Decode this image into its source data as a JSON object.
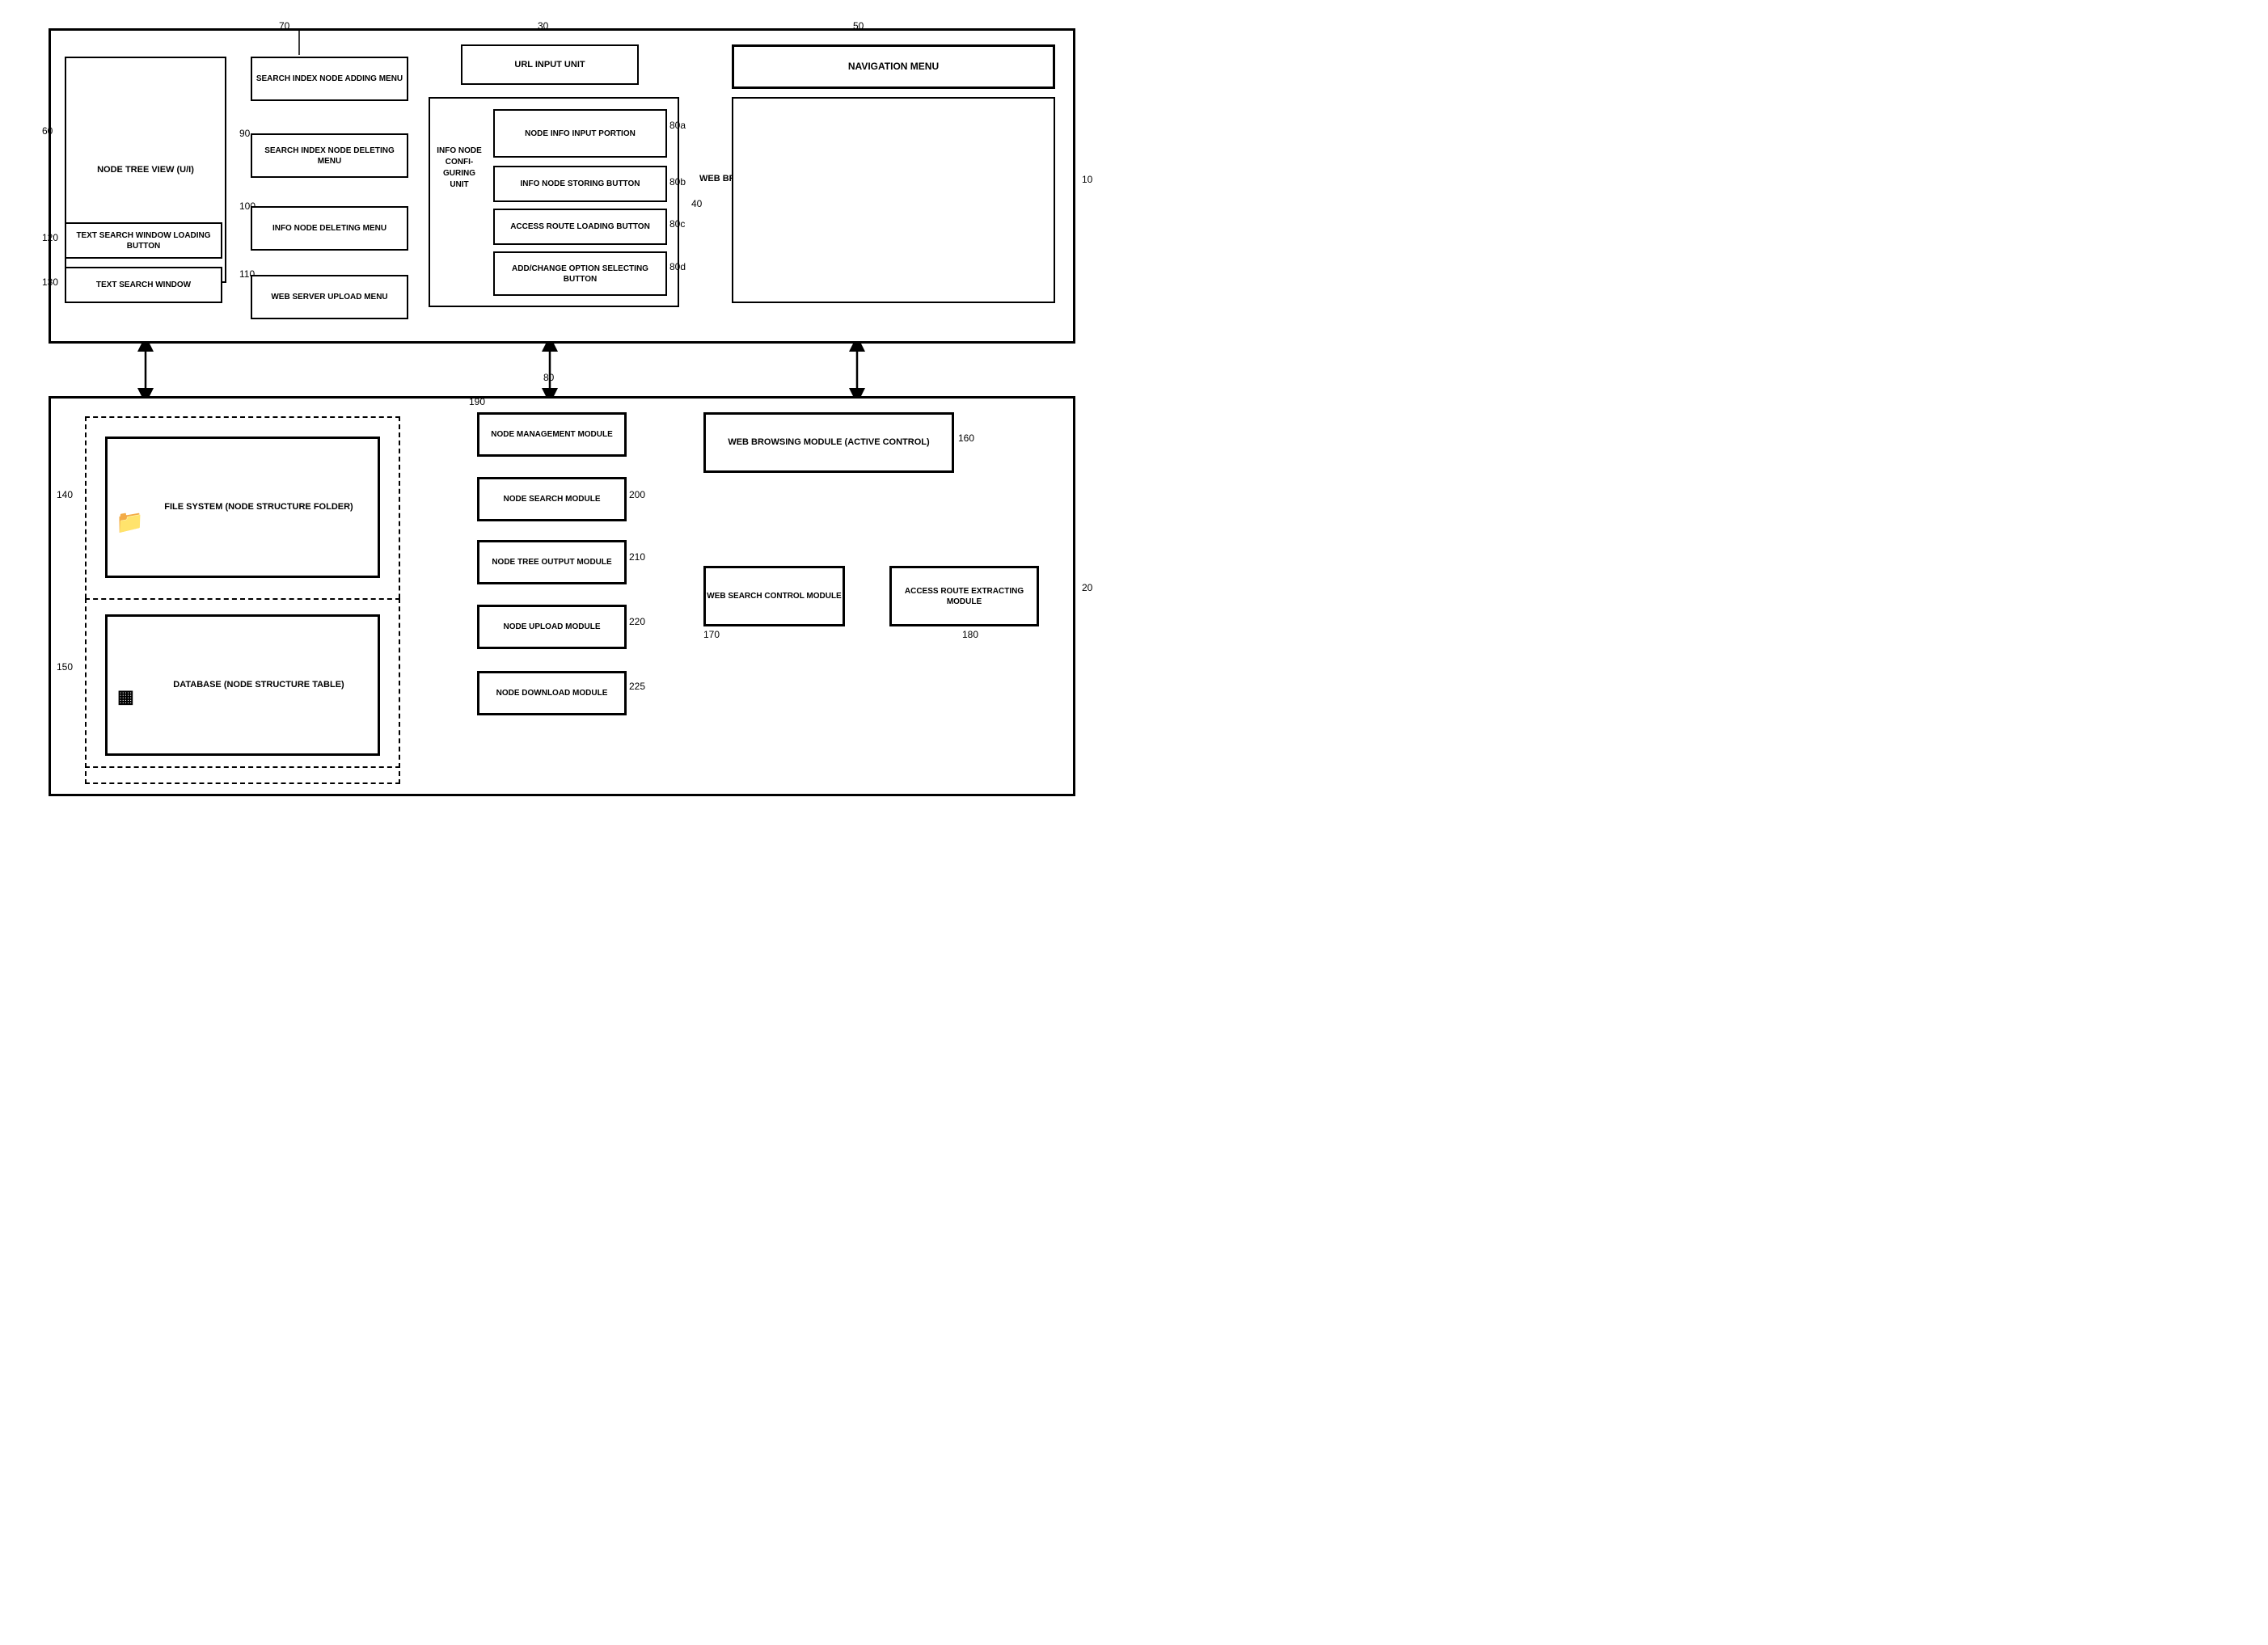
{
  "diagram": {
    "refs": {
      "r10": "10",
      "r20": "20",
      "r30": "30",
      "r40": "40",
      "r50": "50",
      "r60": "60",
      "r70": "70",
      "r80": "80",
      "r80a": "80a",
      "r80b": "80b",
      "r80c": "80c",
      "r80d": "80d",
      "r90": "90",
      "r100": "100",
      "r110": "110",
      "r120": "120",
      "r130": "130",
      "r140": "140",
      "r150": "150",
      "r160": "160",
      "r170": "170",
      "r180": "180",
      "r190": "190",
      "r200": "200",
      "r210": "210",
      "r220": "220",
      "r225": "225"
    },
    "boxes": {
      "web_browser_window": "WEB BROWSER WINDOW (U/I)",
      "node_tree_view": "NODE TREE VIEW\n(U/I)",
      "text_search_window_loading_btn": "TEXT SEARCH WINDOW\nLOADING BUTTON",
      "text_search_window": "TEXT SEARCH WINDOW",
      "search_index_node_adding_menu": "SEARCH INDEX NODE\nADDING MENU",
      "search_index_node_deleting_menu": "SEARCH INDEX NODE\nDELETING MENU",
      "info_node_deleting_menu": "INFO NODE\nDELETING MENU",
      "web_server_upload_menu": "WEB SERVER\nUPLOAD MENU",
      "url_input_unit": "URL INPUT UNIT",
      "info_node_configuring_unit": "INFO\nNODE\nCONFI-\nGURING\nUNIT",
      "node_info_input_portion": "NODE INFO INPUT\nPORTION",
      "info_node_storing_button": "INFO NODE\nSTORING BUTTON",
      "access_route_loading_button": "ACCESS ROUTE\nLOADING BUTTON",
      "add_change_option_selecting_button": "ADD/CHANGE OPTION\nSELECTING BUTTON",
      "navigation_menu": "NAVIGATION MENU",
      "file_system": "FILE SYSTEM\n(NODE STRUCTURE FOLDER)",
      "database": "DATABASE\n(NODE STRUCTURE TABLE)",
      "node_management_module": "NODE MANAGEMENT\nMODULE",
      "node_search_module": "NODE SEARCH\nMODULE",
      "node_tree_output_module": "NODE TREE\nOUTPUT MODULE",
      "node_upload_module": "NODE UPLOAD\nMODULE",
      "node_download_module": "NODE DOWNLOAD\nMODULE",
      "web_browsing_module": "WEB BROWSING MODULE\n(ACTIVE CONTROL)",
      "web_search_control_module": "WEB SEARCH\nCONTROL\nMODULE",
      "access_route_extracting_module": "ACCESS ROUTE\nEXTRACTING\nMODULE"
    }
  }
}
